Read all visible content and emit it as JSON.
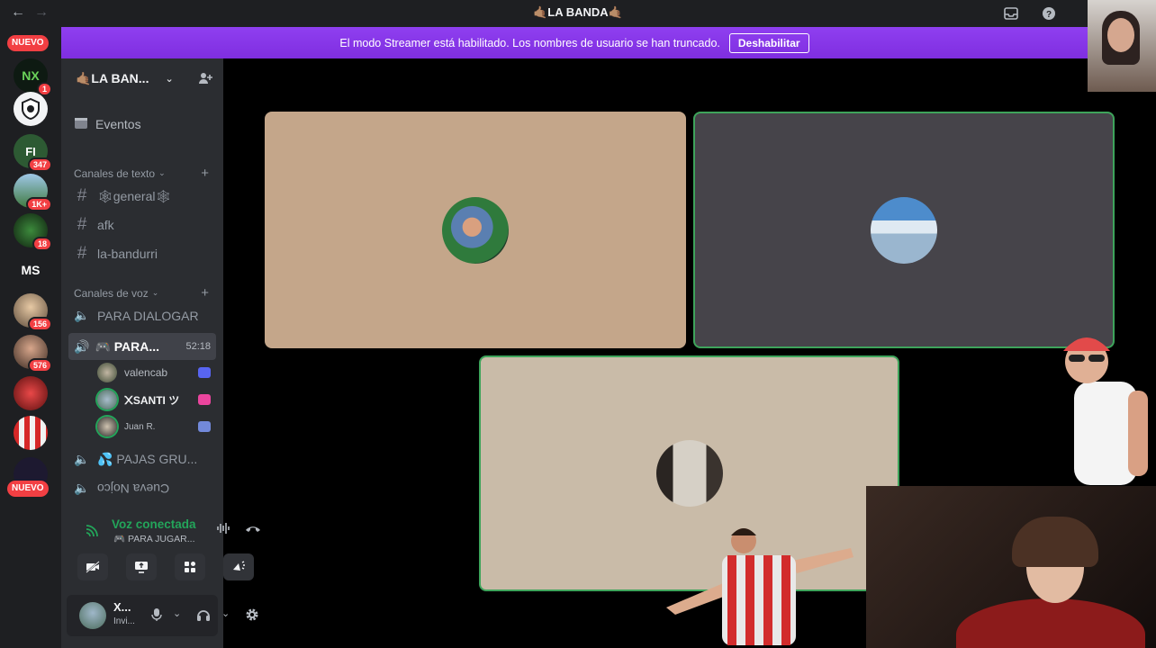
{
  "window": {
    "title": "🤙🏽LA BANDA🤙🏽"
  },
  "banner": {
    "message": "El modo Streamer está habilitado. Los nombres de usuario se han truncado.",
    "button": "Deshabilitar"
  },
  "rail": {
    "new_pill_top": "NUEVO",
    "new_pill_bottom": "NUEVO",
    "badges": [
      "1",
      "347",
      "1K+",
      "18",
      "156",
      "576"
    ],
    "ms_label": "MS"
  },
  "server": {
    "name": "🤙🏽LA BAN..."
  },
  "sidebar": {
    "events": "Eventos",
    "text_category": "Canales de texto",
    "text_channels": [
      "🕸general🕸",
      "afk",
      "la-bandurri"
    ],
    "voice_category": "Canales de voz",
    "voice_channel_1": "PARA DIALOGAR",
    "active_channel": {
      "name": "🎮 PARA...",
      "time": "52:18"
    },
    "voice_users": [
      "valencab",
      "᙭SANTI ツ",
      "Juan R."
    ],
    "voice_channel_3": "💦 PAJAS GRU...",
    "voice_channel_4": "Cueva Nojco"
  },
  "voice_panel": {
    "status": "Voz conectada",
    "channel": "🎮 PARA JUGAR..."
  },
  "user_panel": {
    "name": "X...",
    "status": "Invi..."
  },
  "colors": {
    "banner": "#8a2be2",
    "speaking_border": "#3ea45b",
    "badge": "#f23f43"
  }
}
